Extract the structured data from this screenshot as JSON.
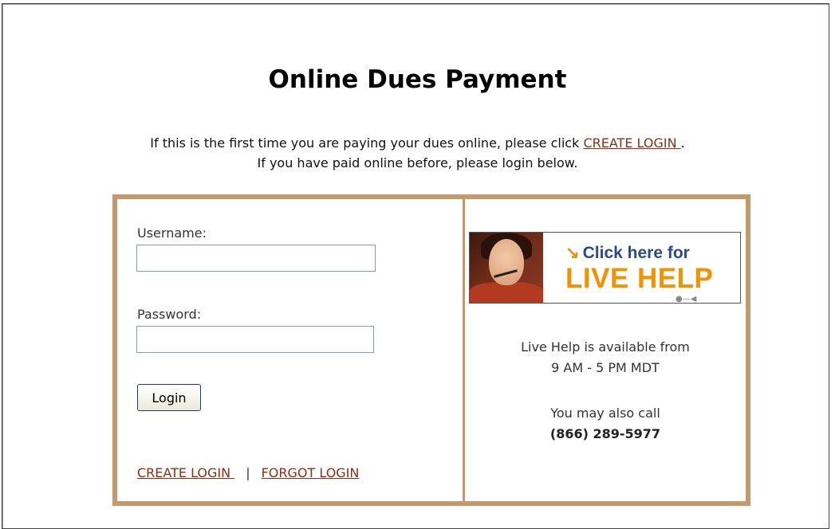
{
  "page": {
    "title": "Online Dues Payment",
    "intro_line1_before": "If this is the first time you are paying your dues online, please click ",
    "intro_link": "CREATE LOGIN ",
    "intro_line1_after": ".",
    "intro_line2": "If you have paid online before, please login below."
  },
  "login_form": {
    "username_label": "Username:",
    "username_value": "",
    "password_label": "Password:",
    "password_value": "",
    "login_button": "Login",
    "create_login_link": "CREATE LOGIN ",
    "separator": "|",
    "forgot_login_link": "FORGOT LOGIN"
  },
  "live_help": {
    "banner_line1": "Click here for",
    "banner_line2": "LIVE HELP",
    "availability_line1": "Live Help is available from",
    "availability_line2": "9 AM - 5 PM MDT",
    "call_text": "You may also call",
    "phone": "(866) 289-5977"
  },
  "colors": {
    "box_border": "#c49a6c",
    "link": "#8a2f12",
    "banner_orange": "#f29200",
    "banner_blue": "#2b4a8a"
  },
  "icons": {
    "banner_arrow": "arrow-down-right-icon",
    "agent_photo": "support-agent-photo"
  }
}
